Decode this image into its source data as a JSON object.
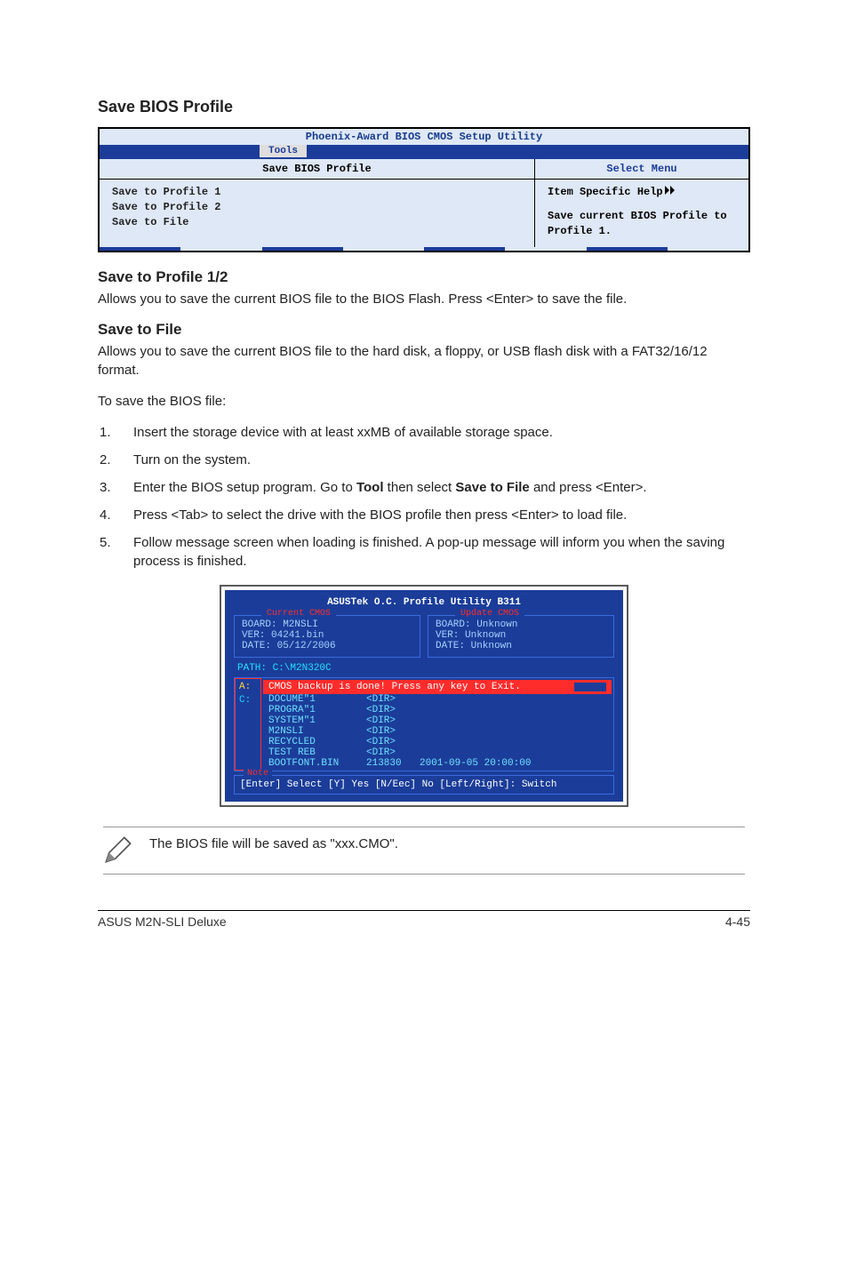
{
  "section_title": "Save BIOS Profile",
  "bios1": {
    "title": "Phoenix-Award BIOS CMOS Setup Utility",
    "tab": "Tools",
    "left_header": "Save BIOS Profile",
    "right_header": "Select Menu",
    "items": [
      "Save to Profile 1",
      "Save to Profile 2",
      "Save to File"
    ],
    "help_label": "Item Specific Help",
    "help_body": "Save current BIOS Profile to Profile 1."
  },
  "sub1_title": "Save to Profile 1/2",
  "sub1_body": "Allows you to save the current BIOS file to the BIOS Flash. Press <Enter> to save the file.",
  "sub2_title": "Save to File",
  "sub2_body": "Allows you to save the current BIOS file to the hard disk, a floppy, or USB flash disk with a FAT32/16/12 format.",
  "tosave": "To save the BIOS file:",
  "steps": [
    "Insert the storage device with at least xxMB of available storage space.",
    "Turn on the system.",
    "Enter the BIOS setup program. Go to Tool then select Save to File and press <Enter>.",
    "Press <Tab> to select the drive with the BIOS profile then press <Enter> to load file.",
    "Follow message screen when loading is finished. A pop-up message will inform you when the saving process is finished."
  ],
  "util": {
    "title": "ASUSTek O.C. Profile Utility B311",
    "current_legend": "Current CMOS",
    "current_lines": [
      "BOARD: M2NSLI",
      "VER: 04241.bin",
      "DATE: 05/12/2006"
    ],
    "update_legend": "Update CMOS",
    "update_lines": [
      "BOARD: Unknown",
      "VER: Unknown",
      "DATE: Unknown"
    ],
    "path": "PATH: C:\\M2N320C",
    "drive_a": "A:",
    "drive_c": "C:",
    "redbox": "CMOS backup is done! Press any key to Exit.",
    "files": [
      {
        "name": "DOCUME\"1",
        "tag": "<DIR>",
        "info": ""
      },
      {
        "name": "PROGRA\"1",
        "tag": "<DIR>",
        "info": ""
      },
      {
        "name": "SYSTEM\"1",
        "tag": "<DIR>",
        "info": ""
      },
      {
        "name": "M2NSLI",
        "tag": "<DIR>",
        "info": ""
      },
      {
        "name": "RECYCLED",
        "tag": "<DIR>",
        "info": ""
      },
      {
        "name": "TEST REB",
        "tag": "<DIR>",
        "info": ""
      },
      {
        "name": "BOOTFONT.BIN",
        "tag": "213830",
        "info": "2001-09-05 20:00:00"
      }
    ],
    "note_legend": "Note",
    "note_text": "[Enter] Select [Y] Yes [N/Eec] No [Left/Right]: Switch"
  },
  "pencil_note": "The BIOS file will be saved as \"xxx.CMO\".",
  "footer_left": "ASUS M2N-SLI Deluxe",
  "footer_right": "4-45"
}
